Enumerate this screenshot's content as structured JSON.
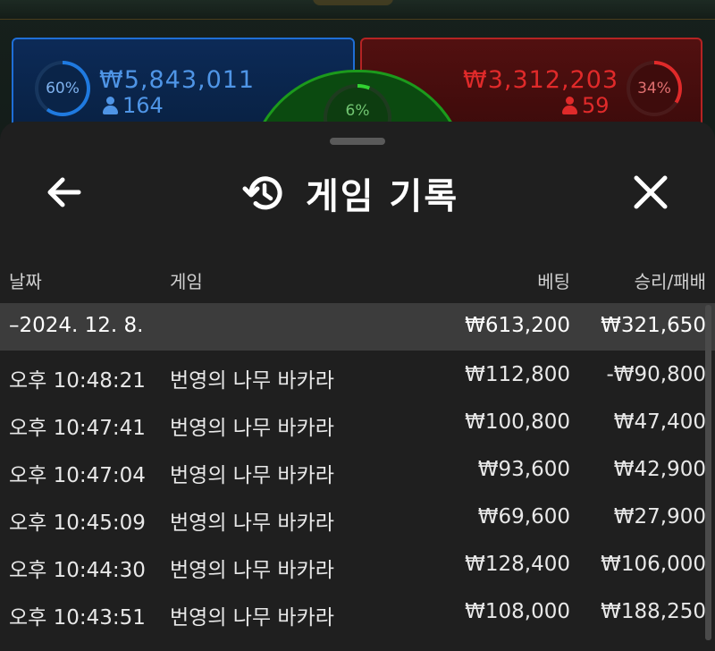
{
  "board": {
    "player": {
      "percent": "60%",
      "amount": "₩5,843,011",
      "count": "164",
      "color": "#1f6ed6"
    },
    "banker": {
      "percent": "34%",
      "amount": "₩3,312,203",
      "count": "59",
      "color": "#b52323"
    },
    "tie": {
      "percent": "6%",
      "color": "#1c9a1c"
    }
  },
  "sheet": {
    "title": "게임 기록",
    "icons": {
      "back": "arrow-left-icon",
      "history": "history-icon",
      "close": "close-icon"
    },
    "columns": {
      "date": "날짜",
      "game": "게임",
      "bet": "베팅",
      "result": "승리/패배"
    },
    "date_group": {
      "label": "–2024. 12. 8.",
      "bet_total": "₩613,200",
      "result_total": "₩321,650"
    },
    "rows": [
      {
        "time": "오후 10:48:21",
        "game": "번영의 나무 바카라",
        "bet": "₩112,800",
        "result": "-₩90,800"
      },
      {
        "time": "오후 10:47:41",
        "game": "번영의 나무 바카라",
        "bet": "₩100,800",
        "result": "₩47,400"
      },
      {
        "time": "오후 10:47:04",
        "game": "번영의 나무 바카라",
        "bet": "₩93,600",
        "result": "₩42,900"
      },
      {
        "time": "오후 10:45:09",
        "game": "번영의 나무 바카라",
        "bet": "₩69,600",
        "result": "₩27,900"
      },
      {
        "time": "오후 10:44:30",
        "game": "번영의 나무 바카라",
        "bet": "₩128,400",
        "result": "₩106,000"
      },
      {
        "time": "오후 10:43:51",
        "game": "번영의 나무 바카라",
        "bet": "₩108,000",
        "result": "₩188,250"
      }
    ]
  }
}
